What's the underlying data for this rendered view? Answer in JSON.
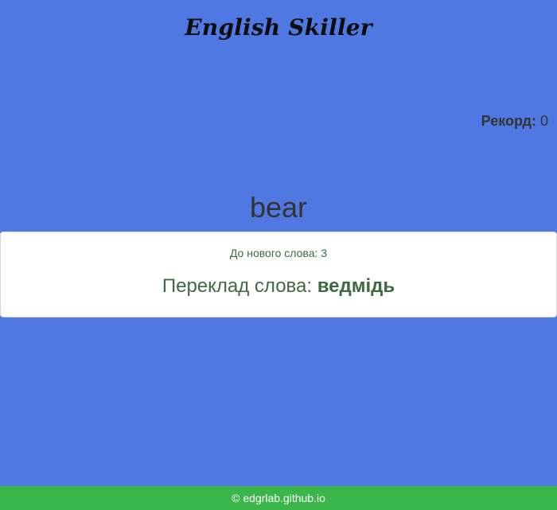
{
  "header": {
    "title": "English Skiller"
  },
  "record": {
    "label": "Рекорд:",
    "value": "0"
  },
  "word": {
    "text": "bear"
  },
  "card": {
    "countdown_label": "До нового слова:",
    "countdown_value": "3",
    "translation_label": "Переклад слова:",
    "translation_value": "ведмідь"
  },
  "footer": {
    "text": "© edgrlab.github.io"
  },
  "colors": {
    "background": "#4f78e2",
    "footer": "#39b54a",
    "card_text": "#3d6a40"
  }
}
